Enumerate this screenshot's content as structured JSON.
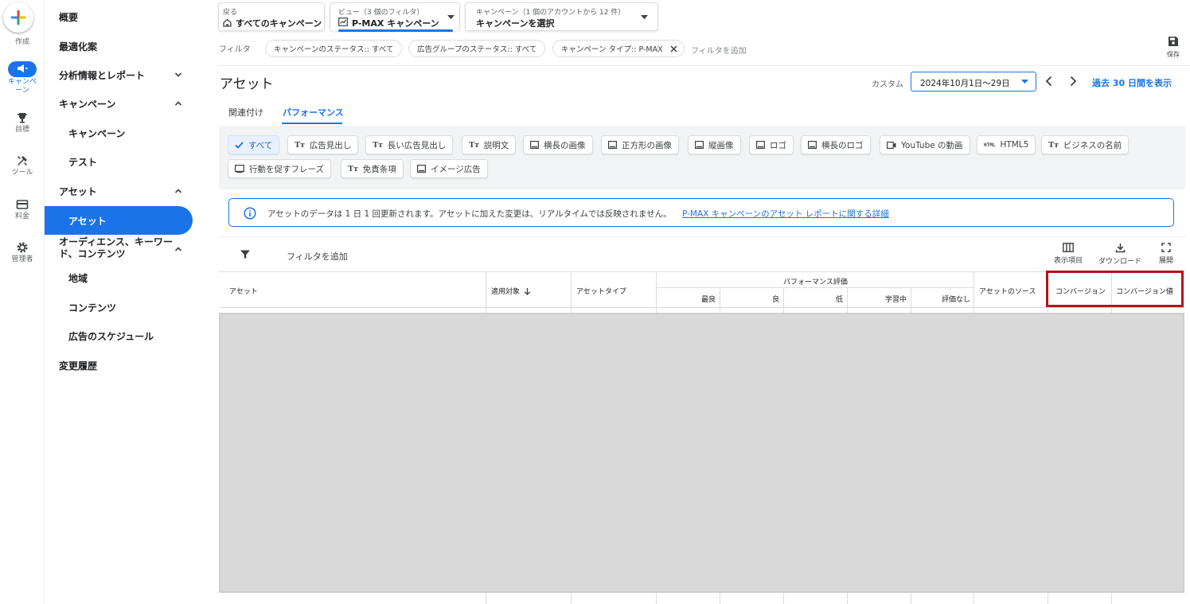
{
  "rail": {
    "create_label": "作成",
    "campaigns_label": "キャンペーン",
    "goals_label": "目標",
    "tools_label": "ツール",
    "billing_label": "料金",
    "admin_label": "管理者"
  },
  "nav": {
    "overview": "概要",
    "recommendations": "最適化案",
    "insights": "分析情報とレポート",
    "campaigns_group": "キャンペーン",
    "campaigns": "キャンペーン",
    "experiments": "テスト",
    "assets_group": "アセット",
    "assets": "アセット",
    "audiences_line1": "オーディエンス、キーワー",
    "audiences_line2": "ド、コンテンツ",
    "locations": "地域",
    "content": "コンテンツ",
    "ad_schedule": "広告のスケジュール",
    "change_history": "変更履歴"
  },
  "header": {
    "back_small": "戻る",
    "back_label": "すべてのキャンペーン",
    "view_small": "ビュー（3 個のフィルタ）",
    "view_label": "P-MAX キャンペーン",
    "campaign_small": "キャンペーン（1 個のアカウントから 12 件）",
    "campaign_label": "キャンペーンを選択",
    "save_label": "保存"
  },
  "filters": {
    "label": "フィルタ",
    "chips": [
      "キャンペーンのステータス:: すべて",
      "広告グループのステータス:: すべて",
      "キャンペーン タイプ:: P-MAX"
    ],
    "add_filter": "フィルタを追加"
  },
  "page": {
    "title": "アセット",
    "date_label": "カスタム",
    "date_range": "2024年10月1日～29日",
    "last30": "過去 30 日間を表示"
  },
  "tabs": [
    "関連付け",
    "パフォーマンス"
  ],
  "asset_types": {
    "all": "すべて",
    "headline": "広告見出し",
    "long_headline": "長い広告見出し",
    "description": "説明文",
    "landscape_image": "横長の画像",
    "square_image": "正方形の画像",
    "portrait_image": "縦画像",
    "logo": "ロゴ",
    "landscape_logo": "横長のロゴ",
    "youtube": "YouTube の動画",
    "html5": "HTML5",
    "business_name": "ビジネスの名前",
    "cta": "行動を促すフレーズ",
    "disclaimer": "免責条項",
    "image_ad": "イメージ広告"
  },
  "info": {
    "text": "アセットのデータは 1 日 1 回更新されます。アセットに加えた変更は、リアルタイムでは反映されません。",
    "link": "P-MAX キャンペーンのアセット レポートに関する詳細"
  },
  "table_toolbar": {
    "add_filter": "フィルタを追加",
    "columns": "表示項目",
    "download": "ダウンロード",
    "expand": "展開"
  },
  "table": {
    "col_asset": "アセット",
    "col_applied": "適用対象",
    "col_type": "アセットタイプ",
    "col_perf_group": "パフォーマンス評価",
    "perf_best": "最良",
    "perf_good": "良",
    "perf_low": "低",
    "perf_learning": "学習中",
    "perf_none": "評価なし",
    "col_source": "アセットのソース",
    "col_conversions": "コンバージョン",
    "col_conv_value": "コンバージョン値"
  },
  "colors": {
    "accent": "#1a73e8",
    "highlight_border": "#b3121a",
    "redacted": "#d9d9d9"
  }
}
